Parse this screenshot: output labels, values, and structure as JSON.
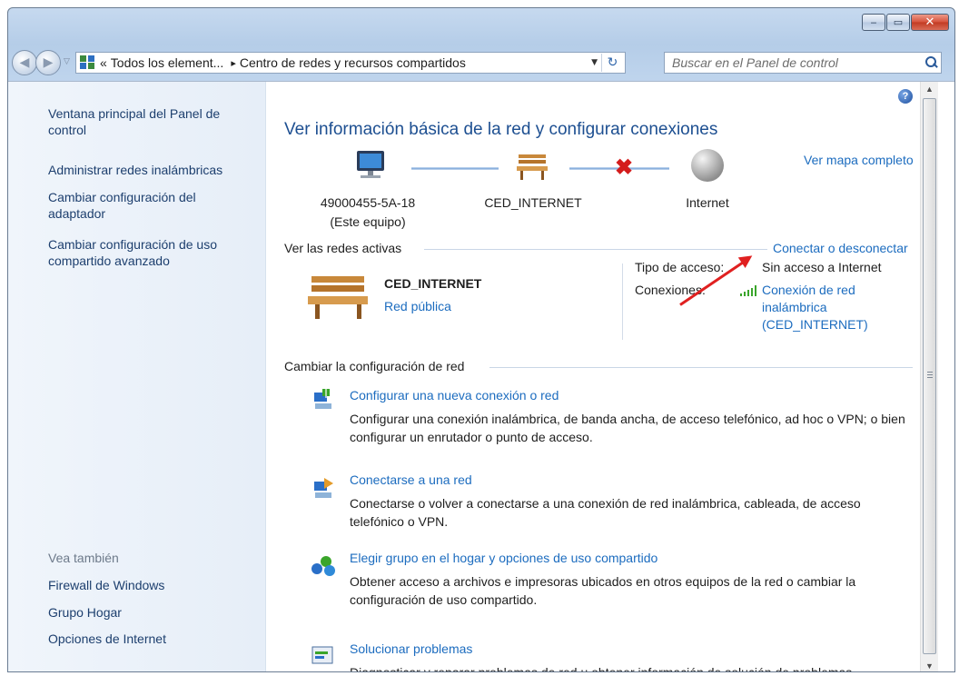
{
  "window": {
    "controls": {
      "minimize": "‒",
      "maximize": "▭",
      "close": "✕"
    }
  },
  "navigation": {
    "address_prefix": "«",
    "address_part1": "Todos los element...",
    "address_sep": "▸",
    "address_part2": "Centro de redes y recursos compartidos",
    "search_placeholder": "Buscar en el Panel de control"
  },
  "sidebar": {
    "home_link": "Ventana principal del Panel de control",
    "links": [
      "Administrar redes inalámbricas",
      "Cambiar configuración del adaptador",
      "Cambiar configuración de uso compartido avanzado"
    ],
    "see_also_heading": "Vea también",
    "see_also": [
      "Firewall de Windows",
      "Grupo Hogar",
      "Opciones de Internet"
    ]
  },
  "main": {
    "title": "Ver información básica de la red y configurar conexiones",
    "view_full_map": "Ver mapa completo",
    "map": {
      "computer_name": "49000455-5A-18",
      "computer_sub": "(Este equipo)",
      "network_name": "CED_INTERNET",
      "internet_label": "Internet"
    },
    "active_networks_heading": "Ver las redes activas",
    "connect_disconnect": "Conectar o desconectar",
    "active_network": {
      "name": "CED_INTERNET",
      "type": "Red pública",
      "access_label": "Tipo de acceso:",
      "access_value": "Sin acceso a Internet",
      "connections_label": "Conexiones:",
      "connection_line1": "Conexión de red",
      "connection_line2": "inalámbrica",
      "connection_line3": "(CED_INTERNET)"
    },
    "change_settings_heading": "Cambiar la configuración de red",
    "tasks": [
      {
        "title": "Configurar una nueva conexión o red",
        "desc": "Configurar una conexión inalámbrica, de banda ancha, de acceso telefónico, ad hoc o VPN; o bien configurar un enrutador o punto de acceso."
      },
      {
        "title": "Conectarse a una red",
        "desc": "Conectarse o volver a conectarse a una conexión de red inalámbrica, cableada, de acceso telefónico o VPN."
      },
      {
        "title": "Elegir grupo en el hogar y opciones de uso compartido",
        "desc": "Obtener acceso a archivos e impresoras ubicados en otros equipos de la red o cambiar la configuración de uso compartido."
      },
      {
        "title": "Solucionar problemas",
        "desc": "Diagnosticar y reparar problemas de red u obtener información de solución de problemas."
      }
    ]
  },
  "colors": {
    "link": "#1c6cbf",
    "title": "#1d4f91",
    "accent_arrow": "#e02020",
    "signal": "#3aa52b"
  }
}
